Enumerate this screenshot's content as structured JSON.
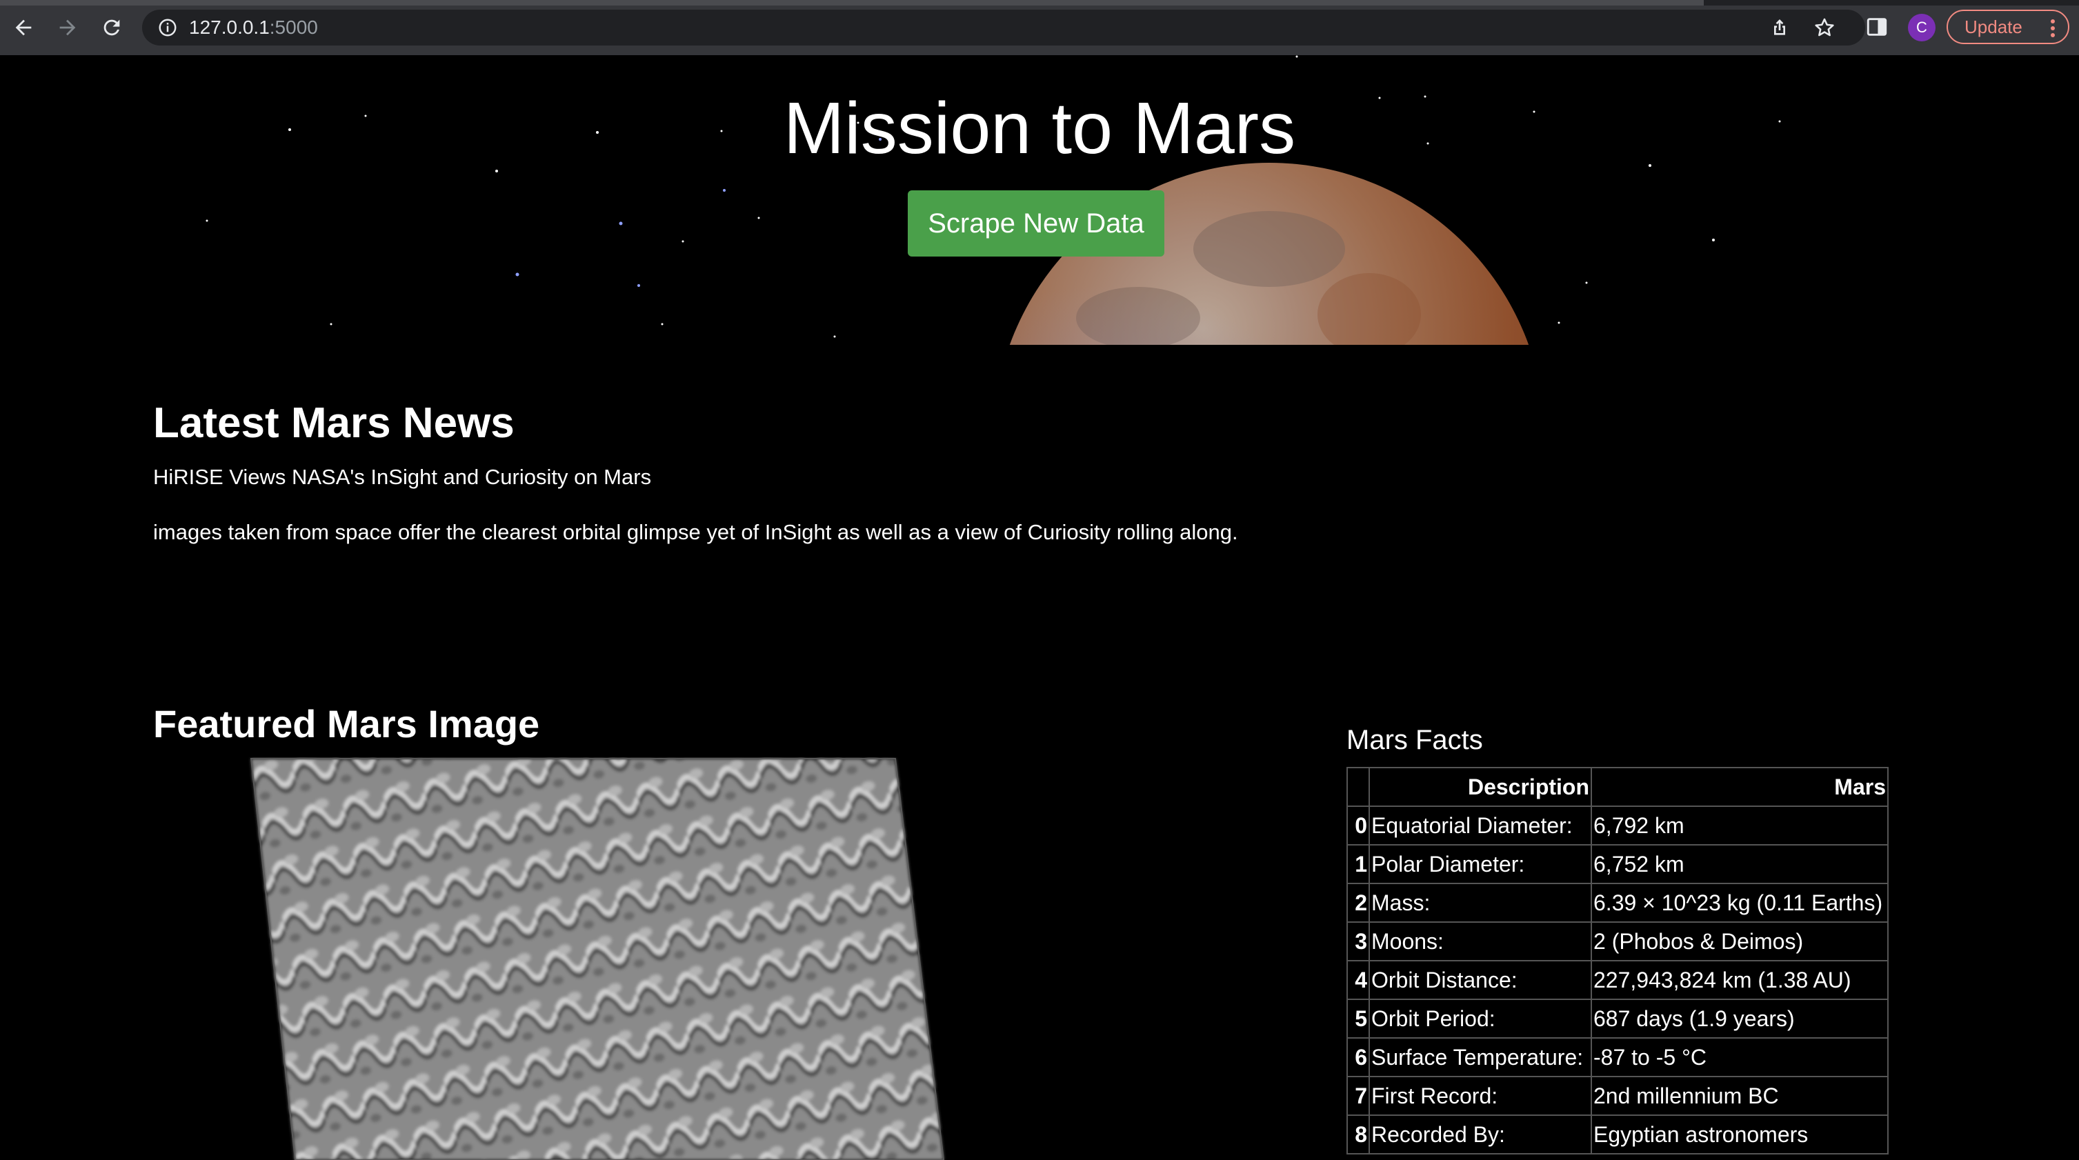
{
  "browser": {
    "url_host": "127.0.0.1",
    "url_port": ":5000",
    "avatar_initial": "C",
    "update_label": "Update"
  },
  "hero": {
    "title": "Mission to Mars",
    "scrape_button": "Scrape New Data"
  },
  "news": {
    "section_title": "Latest Mars News",
    "headline": "HiRISE Views NASA's InSight and Curiosity on Mars",
    "paragraph": "images taken from space offer the clearest orbital glimpse yet of InSight as well as a view of Curiosity rolling along."
  },
  "featured": {
    "section_title": "Featured Mars Image"
  },
  "facts": {
    "section_title": "Mars Facts",
    "headers": [
      "",
      "Description",
      "Mars"
    ],
    "rows": [
      {
        "index": "0",
        "description": "Equatorial Diameter:",
        "value": "6,792 km"
      },
      {
        "index": "1",
        "description": "Polar Diameter:",
        "value": "6,752 km"
      },
      {
        "index": "2",
        "description": "Mass:",
        "value": "6.39 × 10^23 kg (0.11 Earths)"
      },
      {
        "index": "3",
        "description": "Moons:",
        "value": "2 (Phobos & Deimos)"
      },
      {
        "index": "4",
        "description": "Orbit Distance:",
        "value": "227,943,824 km (1.38 AU)"
      },
      {
        "index": "5",
        "description": "Orbit Period:",
        "value": "687 days (1.9 years)"
      },
      {
        "index": "6",
        "description": "Surface Temperature:",
        "value": "-87 to -5 °C"
      },
      {
        "index": "7",
        "description": "First Record:",
        "value": "2nd millennium BC"
      },
      {
        "index": "8",
        "description": "Recorded By:",
        "value": "Egyptian astronomers"
      }
    ]
  },
  "colors": {
    "page_background": "#000000",
    "scrape_button": "#4aa04a",
    "update_accent": "#f28b82",
    "avatar": "#7b2fb5"
  }
}
